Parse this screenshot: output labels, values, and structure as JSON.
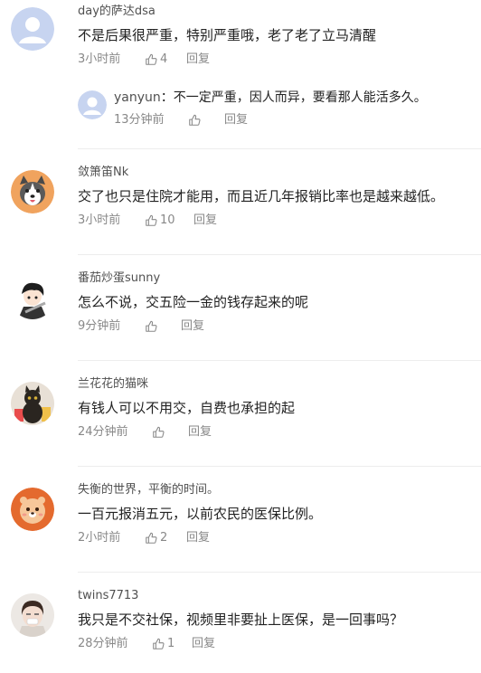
{
  "comments": [
    {
      "username": "day的萨达dsa",
      "text": "不是后果很严重，特别严重哦，老了老了立马清醒",
      "time": "3小时前",
      "likes": "4",
      "reply_label": "回复",
      "avatar_icon": "default-avatar-icon",
      "replies": [
        {
          "username": "yanyun",
          "separator": "：",
          "text": "不一定严重，因人而异，要看那人能活多久。",
          "time": "13分钟前",
          "likes": "",
          "reply_label": "回复",
          "avatar_icon": "default-avatar-icon"
        }
      ]
    },
    {
      "username": "敛箫笛Nk",
      "text": "交了也只是住院才能用，而且近几年报销比率也是越来越低。",
      "time": "3小时前",
      "likes": "10",
      "reply_label": "回复",
      "avatar_icon": "husky-avatar-icon"
    },
    {
      "username": "番茄炒蛋sunny",
      "text": "怎么不说，交五险一金的钱存起来的呢",
      "time": "9分钟前",
      "likes": "",
      "reply_label": "回复",
      "avatar_icon": "anime-boy-avatar-icon"
    },
    {
      "username": "兰花花的猫咪",
      "text": "有钱人可以不用交，自费也承担的起",
      "time": "24分钟前",
      "likes": "",
      "reply_label": "回复",
      "avatar_icon": "cat-avatar-icon"
    },
    {
      "username": "失衡的世界，平衡的时间。",
      "text": "一百元报消五元，以前农民的医保比例。",
      "time": "2小时前",
      "likes": "2",
      "reply_label": "回复",
      "avatar_icon": "lion-avatar-icon"
    },
    {
      "username": "twins7713",
      "text": "我只是不交社保，视频里非要扯上医保，是一回事吗？",
      "time": "28分钟前",
      "likes": "1",
      "reply_label": "回复",
      "avatar_icon": "girl-photo-avatar-icon"
    }
  ],
  "colors": {
    "text": "#222222",
    "username": "#505050",
    "meta": "#888888",
    "divider": "#ededed",
    "default_avatar_bg": "#c7d4f0"
  }
}
